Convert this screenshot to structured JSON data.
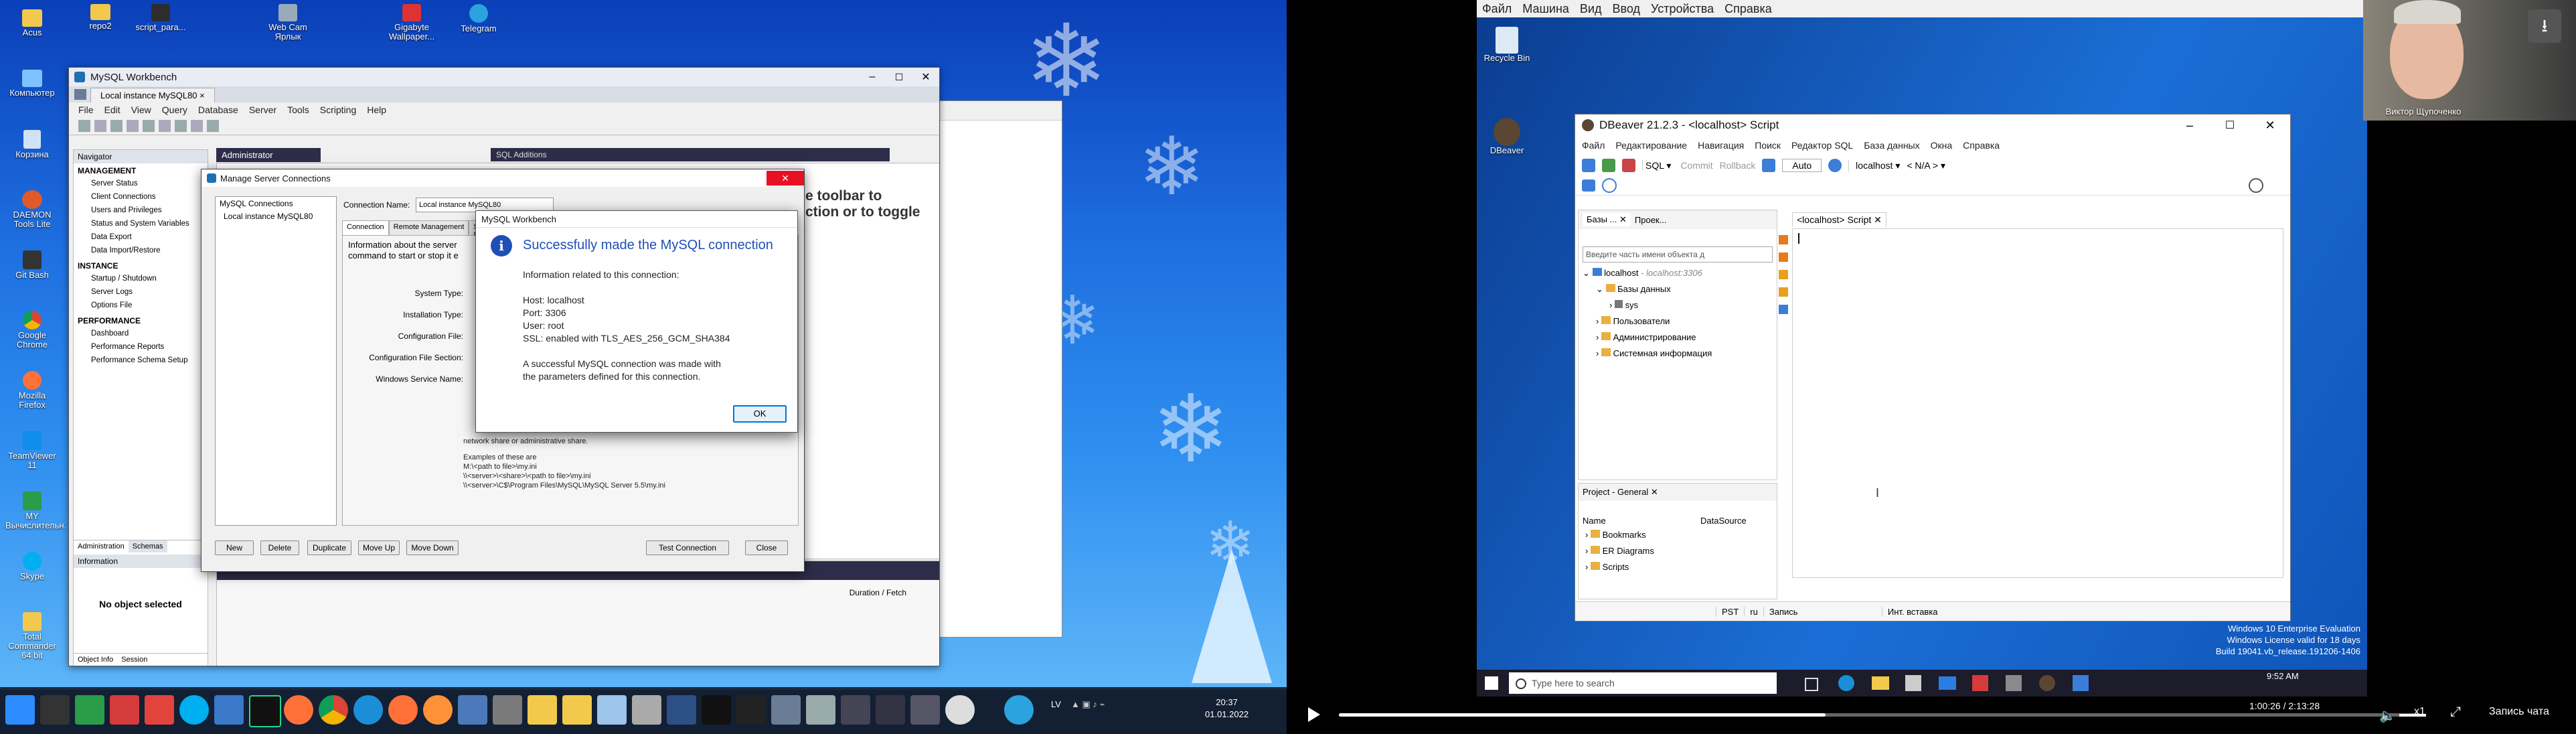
{
  "left_desktop": {
    "icons_col1": [
      "Acus",
      "Компьютер",
      "Корзина",
      "DAEMON Tools Lite",
      "Git Bash",
      "Google Chrome",
      "Mozilla Firefox",
      "TeamViewer 11",
      "MY Вычислительн.",
      "Skype",
      "Total Commander 64 bit"
    ],
    "icons_top": [
      "repo2",
      "script_para...",
      "Web Cam Ярлык",
      "Gigabyte Wallpaper...",
      "Telegram"
    ]
  },
  "workbench": {
    "title": "MySQL Workbench",
    "tab": "Local instance MySQL80",
    "menu": [
      "File",
      "Edit",
      "View",
      "Query",
      "Database",
      "Server",
      "Tools",
      "Scripting",
      "Help"
    ],
    "navigator_header": "Navigator",
    "management_header": "MANAGEMENT",
    "management_items": [
      "Server Status",
      "Client Connections",
      "Users and Privileges",
      "Status and System Variables",
      "Data Export",
      "Data Import/Restore"
    ],
    "instance_header": "INSTANCE",
    "instance_items": [
      "Startup / Shutdown",
      "Server Logs",
      "Options File"
    ],
    "performance_header": "PERFORMANCE",
    "performance_items": [
      "Dashboard",
      "Performance Reports",
      "Performance Schema Setup"
    ],
    "nav_tabs": [
      "Administration",
      "Schemas"
    ],
    "info_header": "Information",
    "no_object": "No object selected",
    "bottom_tabs": [
      "Object Info",
      "Session"
    ],
    "admin_tab": "Administrator",
    "sql_additions": "SQL Additions",
    "hint_line1": "e toolbar to",
    "hint_line2": "ction or to toggle",
    "duration": "Duration / Fetch"
  },
  "manage_dialog": {
    "title": "Manage Server Connections",
    "list_header": "MySQL Connections",
    "list_item": "Local instance MySQL80",
    "conn_name_label": "Connection Name:",
    "conn_name_value": "Local instance MySQL80",
    "tabs": [
      "Connection",
      "Remote Management",
      "System Profile"
    ],
    "info_text1": "Information about the server",
    "info_text2": "command to start or stop it e",
    "fields": [
      "System Type:",
      "Installation Type:",
      "Configuration File:",
      "Configuration File Section:",
      "Windows Service Name:"
    ],
    "help_text": "network share or administrative share.",
    "examples_title": "Examples of these are",
    "examples": [
      "M:\\<path to file>\\my.ini",
      "\\\\<server>\\<share>\\<path to file>\\my.ini",
      "\\\\<server>\\C$\\Program Files\\MySQL\\MySQL Server 5.5\\my.ini"
    ],
    "buttons": [
      "New",
      "Delete",
      "Duplicate",
      "Move Up",
      "Move Down",
      "Test Connection",
      "Close"
    ]
  },
  "success_dialog": {
    "title": "MySQL Workbench",
    "heading": "Successfully made the MySQL connection",
    "intro": "Information related to this connection:",
    "host": "Host: localhost",
    "port": "Port: 3306",
    "user": "User: root",
    "ssl": "SSL: enabled with TLS_AES_256_GCM_SHA384",
    "note1": "A successful MySQL connection was made with",
    "note2": "the parameters defined for this connection.",
    "ok": "OK"
  },
  "left_taskbar": {
    "lang": "LV",
    "time": "20:37",
    "date": "01.01.2022"
  },
  "vm": {
    "menu": [
      "Файл",
      "Машина",
      "Вид",
      "Ввод",
      "Устройства",
      "Справка"
    ],
    "recycle_bin": "Recycle Bin",
    "dbeaver_icon": "DBeaver",
    "watermark": [
      "Windows 10 Enterprise Evaluation",
      "Windows License valid for 18 days",
      "Build 19041.vb_release.191206-1406"
    ],
    "search_placeholder": "Type here to search",
    "clock": "9:52 AM"
  },
  "dbeaver": {
    "title": "DBeaver 21.2.3 - <localhost> Script",
    "menu": [
      "Файл",
      "Редактирование",
      "Навигация",
      "Поиск",
      "Редактор SQL",
      "База данных",
      "Окна",
      "Справка"
    ],
    "toolbar_sql": "SQL",
    "toolbar_commit": "Commit",
    "toolbar_rollback": "Rollback",
    "toolbar_auto": "Auto",
    "toolbar_host": "localhost",
    "toolbar_na": "< N/A >",
    "nav_tabs": [
      "Базы ...",
      "Проек..."
    ],
    "filter_placeholder": "Введите часть имени объекта д",
    "tree_root": "localhost",
    "tree_root_detail": "- localhost:3306",
    "tree_items": [
      "Базы данных",
      "sys",
      "Пользователи",
      "Администрирование",
      "Системная информация"
    ],
    "editor_tab": "<localhost> Script",
    "project_title": "Project - General",
    "project_cols": [
      "Name",
      "DataSource"
    ],
    "project_items": [
      "Bookmarks",
      "ER Diagrams",
      "Scripts"
    ],
    "status": [
      "PST",
      "ru",
      "Запись",
      "Инт. вставка"
    ]
  },
  "webcam": {
    "name": "Виктор Щупоченко"
  },
  "player": {
    "current": "1:00:26",
    "total": "2:13:28",
    "progress": 0.45,
    "speed": "x1",
    "record": "Запись чата"
  }
}
